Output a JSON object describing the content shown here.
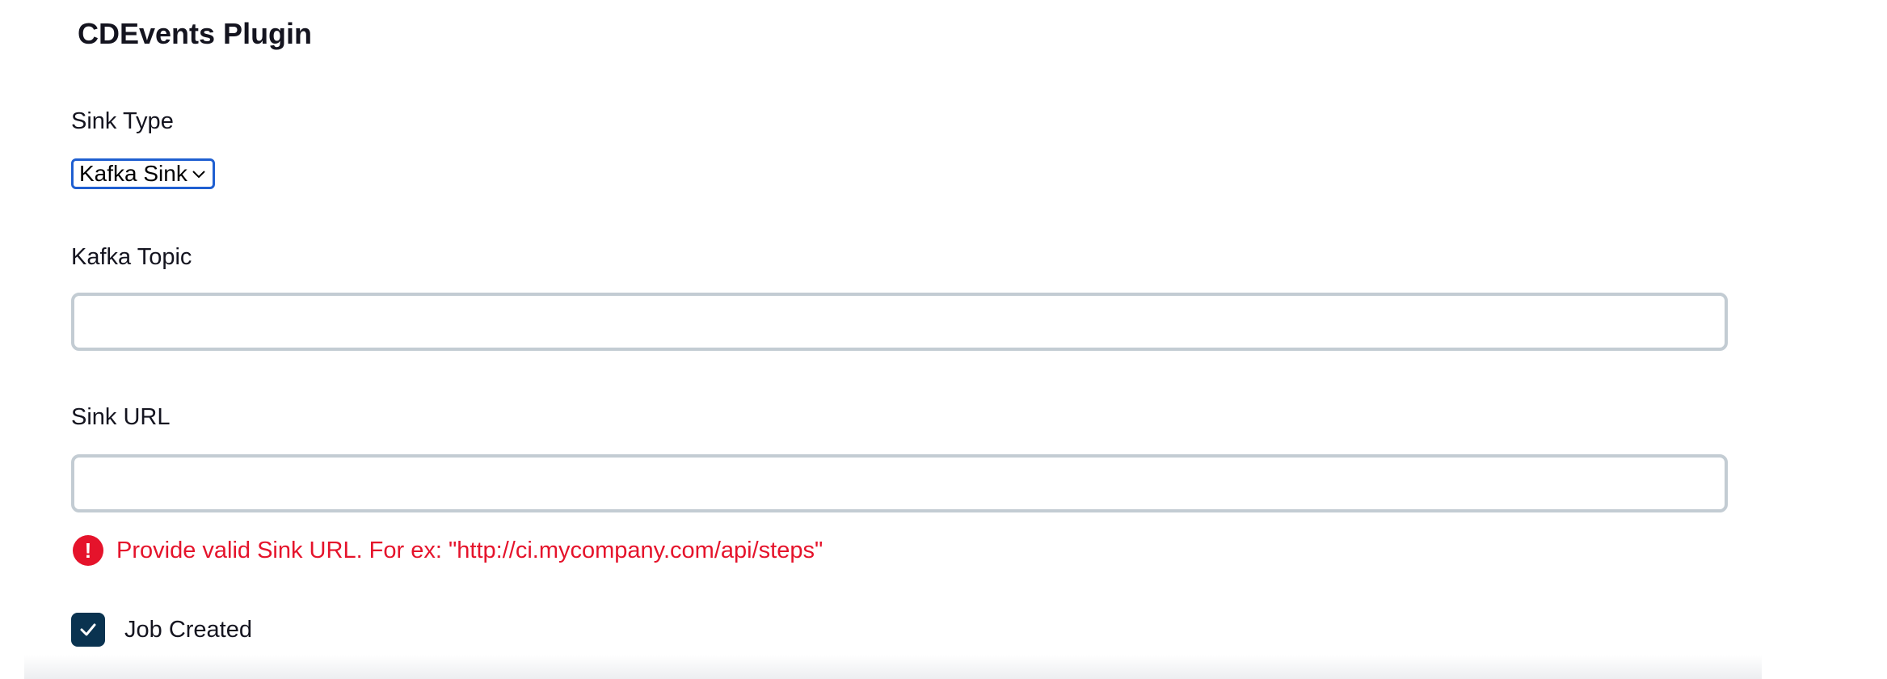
{
  "section": {
    "title": "CDEvents Plugin"
  },
  "sink_type": {
    "label": "Sink Type",
    "selected": "Kafka Sink"
  },
  "kafka_topic": {
    "label": "Kafka Topic",
    "value": ""
  },
  "sink_url": {
    "label": "Sink URL",
    "value": "",
    "error": "Provide valid Sink URL. For ex: \"http://ci.mycompany.com/api/steps\"",
    "error_icon": "!"
  },
  "job_created": {
    "label": "Job Created",
    "checked": true
  },
  "colors": {
    "error": "#e5132b",
    "checkbox_fill": "#0a3350",
    "select_border": "#1f5fd1",
    "input_border": "#c3ccd3"
  }
}
